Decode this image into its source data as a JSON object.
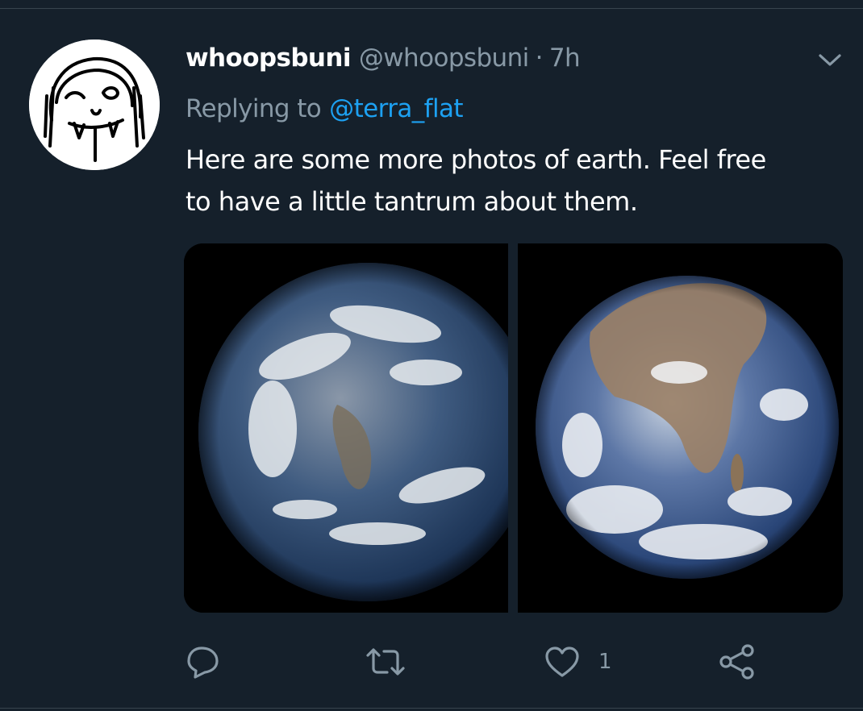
{
  "tweet": {
    "display_name": "whoopsbuni",
    "handle": "@whoopsbuni",
    "separator": "·",
    "timestamp": "7h",
    "replying_to_label": "Replying to",
    "replying_to_handle": "@terra_flat",
    "text_lines": [
      "Here are some more photos of earth. Feel free",
      "to have a little tantrum about them."
    ],
    "photos": [
      {
        "icon": "earth-photo-americas"
      },
      {
        "icon": "earth-photo-africa"
      }
    ]
  },
  "actions": {
    "reply_icon": "comment-icon",
    "retweet_icon": "retweet-icon",
    "like_icon": "heart-icon",
    "like_count": "1",
    "share_icon": "share-icon"
  },
  "colors": {
    "background": "#15202b",
    "secondary_text": "#8899a6",
    "link": "#1da1f2",
    "divider": "#38444d"
  }
}
